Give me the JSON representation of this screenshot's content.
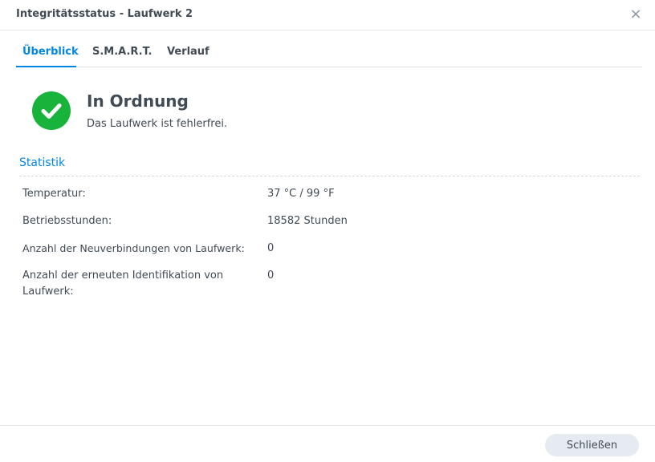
{
  "window": {
    "title": "Integritätsstatus - Laufwerk 2",
    "close_glyph": "×"
  },
  "tabs": [
    {
      "label": "Überblick",
      "active": true
    },
    {
      "label": "S.M.A.R.T.",
      "active": false
    },
    {
      "label": "Verlauf",
      "active": false
    }
  ],
  "status": {
    "icon": "checkmark-circle-icon",
    "color": "#17b33a",
    "title": "In Ordnung",
    "description": "Das Laufwerk ist fehlerfrei."
  },
  "statistics": {
    "heading": "Statistik",
    "rows": [
      {
        "label": "Temperatur:",
        "value": "37 °C / 99 °F"
      },
      {
        "label": "Betriebsstunden:",
        "value": "18582 Stunden"
      },
      {
        "label": "Anzahl der Neuverbindungen von Laufwerk:",
        "value": "0"
      },
      {
        "label": "Anzahl der erneuten Identifikation von Laufwerk:",
        "value": "0"
      }
    ]
  },
  "footer": {
    "close_label": "Schließen"
  },
  "colors": {
    "accent": "#0086e5",
    "success": "#17b33a",
    "text": "#414b55"
  }
}
